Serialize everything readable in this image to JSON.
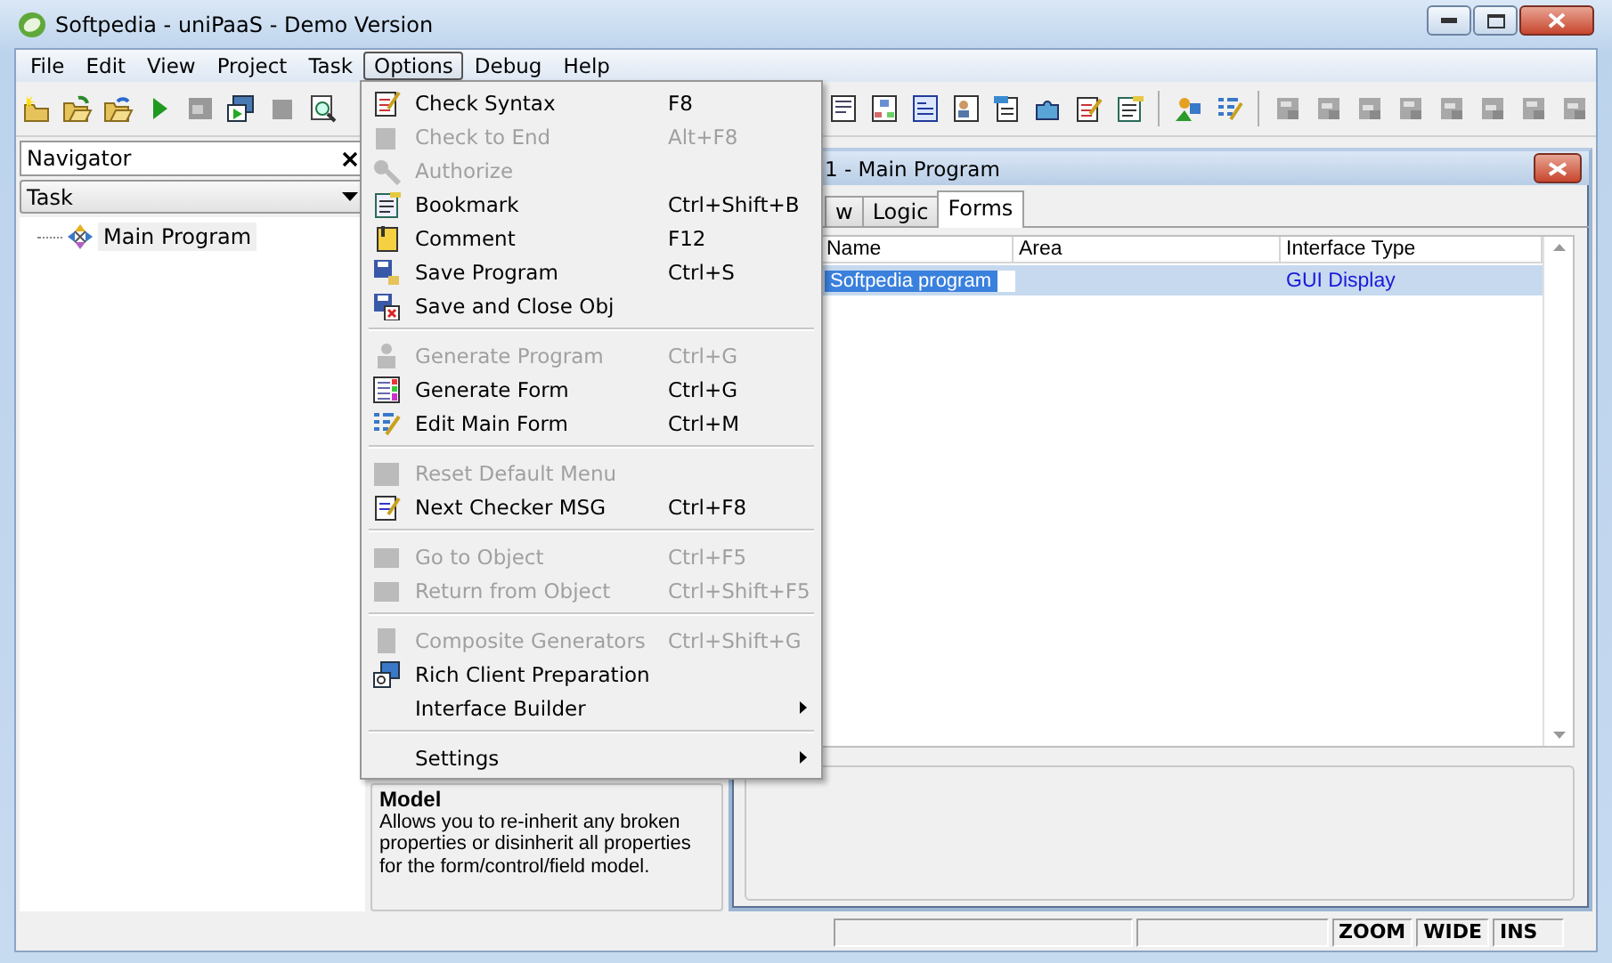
{
  "window": {
    "title": "Softpedia - uniPaaS - Demo Version"
  },
  "menu_bar": [
    {
      "label": "File",
      "selected": false
    },
    {
      "label": "Edit",
      "selected": false
    },
    {
      "label": "View",
      "selected": false
    },
    {
      "label": "Project",
      "selected": false
    },
    {
      "label": "Task",
      "selected": false
    },
    {
      "label": "Options",
      "selected": true
    },
    {
      "label": "Debug",
      "selected": false
    },
    {
      "label": "Help",
      "selected": false
    }
  ],
  "options_menu": [
    {
      "kind": "item",
      "label": "Check Syntax",
      "shortcut": "F8",
      "disabled": false
    },
    {
      "kind": "item",
      "label": "Check to End",
      "shortcut": "Alt+F8",
      "disabled": true
    },
    {
      "kind": "item",
      "label": "Authorize",
      "disabled": true
    },
    {
      "kind": "item",
      "label": "Bookmark",
      "shortcut": "Ctrl+Shift+B",
      "disabled": false
    },
    {
      "kind": "item",
      "label": "Comment",
      "shortcut": "F12",
      "disabled": false
    },
    {
      "kind": "item",
      "label": "Save Program",
      "shortcut": "Ctrl+S",
      "disabled": false
    },
    {
      "kind": "item",
      "label": "Save and Close Obj",
      "disabled": false
    },
    {
      "kind": "separator"
    },
    {
      "kind": "item",
      "label": "Generate Program",
      "shortcut": "Ctrl+G",
      "disabled": true
    },
    {
      "kind": "item",
      "label": "Generate Form",
      "shortcut": "Ctrl+G",
      "disabled": false
    },
    {
      "kind": "item",
      "label": "Edit Main Form",
      "shortcut": "Ctrl+M",
      "disabled": false
    },
    {
      "kind": "separator"
    },
    {
      "kind": "item",
      "label": "Reset Default Menu",
      "disabled": true
    },
    {
      "kind": "item",
      "label": "Next Checker MSG",
      "shortcut": "Ctrl+F8",
      "disabled": false
    },
    {
      "kind": "separator"
    },
    {
      "kind": "item",
      "label": "Go to Object",
      "shortcut": "Ctrl+F5",
      "disabled": true
    },
    {
      "kind": "item",
      "label": "Return from Object",
      "shortcut": "Ctrl+Shift+F5",
      "disabled": true
    },
    {
      "kind": "separator"
    },
    {
      "kind": "item",
      "label": "Composite Generators",
      "shortcut": "Ctrl+Shift+G",
      "disabled": true
    },
    {
      "kind": "item",
      "label": "Rich Client Preparation",
      "disabled": false
    },
    {
      "kind": "submenu",
      "label": "Interface Builder",
      "disabled": false
    },
    {
      "kind": "separator"
    },
    {
      "kind": "submenu",
      "label": "Settings",
      "disabled": false
    }
  ],
  "navigator": {
    "title": "Navigator",
    "filter": "Task",
    "tree": [
      {
        "label": "Main Program"
      }
    ]
  },
  "help": {
    "title": "Model",
    "text": "Allows you to re-inherit any broken properties or disinherit all properties for the form/control/field model."
  },
  "child_window": {
    "title": "1 -   Main Program",
    "tabs": [
      {
        "label": "w",
        "selected": false
      },
      {
        "label": "Logic",
        "selected": false
      },
      {
        "label": "Forms",
        "selected": true
      }
    ],
    "table": {
      "columns": [
        "Name",
        "Area",
        "Interface Type"
      ],
      "rows": [
        {
          "name": "Softpedia program",
          "interface_type": "GUI Display",
          "selected": true
        }
      ]
    }
  },
  "status_bar": [
    "ZOOM",
    "WIDE",
    "INS"
  ]
}
